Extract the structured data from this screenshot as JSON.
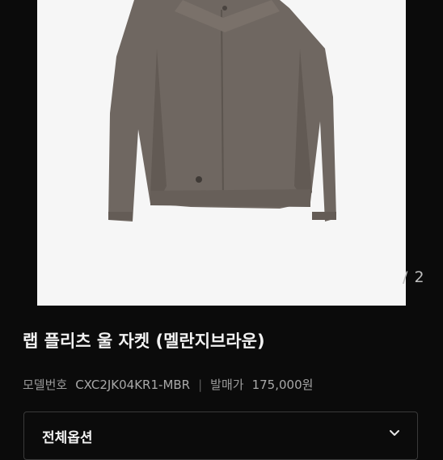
{
  "gallery": {
    "image_alt": "product-photo-jacket",
    "page_counter": "/ 2"
  },
  "product": {
    "title": "랩 플리츠 울 자켓 (멜란지브라운)",
    "model_label": "모델번호",
    "model_value": "CXC2JK04KR1-MBR",
    "release_label": "발매가",
    "release_value": "175,000원"
  },
  "options": {
    "label": "전체옵션",
    "icon": "chevron-down-icon"
  }
}
